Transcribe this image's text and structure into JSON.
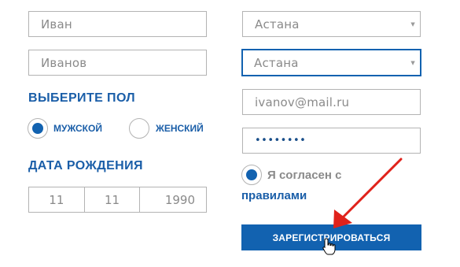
{
  "form": {
    "first_name": {
      "value": "Иван"
    },
    "last_name": {
      "value": "Иванов"
    },
    "gender": {
      "heading": "ВЫБЕРИТЕ ПОЛ",
      "male_label": "МУЖСКОЙ",
      "female_label": "ЖЕНСКИЙ",
      "selected": "male"
    },
    "birth_date": {
      "heading": "ДАТА РОЖДЕНИЯ",
      "day": "11",
      "month": "11",
      "year": "1990"
    },
    "city_1": {
      "selected": "Астана"
    },
    "city_2": {
      "selected": "Астана"
    },
    "email": {
      "value": "ivanov@mail.ru"
    },
    "password": {
      "masked": "••••••••"
    },
    "agreement": {
      "checked": true,
      "text": "Я согласен с",
      "link": "правилами"
    },
    "submit_label": "ЗАРЕГИСТРИРОВАТЬСЯ"
  },
  "icons": {
    "select_arrow": "chevron-down-icon",
    "pointer": "hand-pointer-icon",
    "annotation": "arrow-icon"
  },
  "colors": {
    "accent": "#1262b0",
    "heading": "#1a5ea8",
    "annotation_arrow": "#e0221b",
    "border": "#b3b3b3",
    "text_muted": "#8a8a8a"
  }
}
